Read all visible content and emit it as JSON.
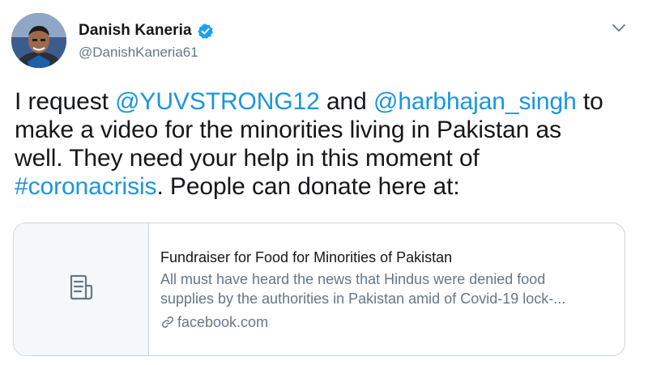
{
  "author": {
    "display_name": "Danish Kaneria",
    "handle": "@DanishKaneria61",
    "verified_icon": "verified-badge-icon",
    "avatar_icon": "profile-photo",
    "colors": {
      "verified": "#1da1f2",
      "secondary_text": "#657786"
    }
  },
  "tweet": {
    "line1_prefix": "I request ",
    "mention1": "@YUVSTRONG12",
    "line1_middle": " and ",
    "mention2": "@harbhajan_singh",
    "line1_suffix": " to",
    "line2": "make a video for the minorities living in Pakistan as",
    "line3": "well. They need your help in this moment of",
    "hashtag": "#coronacrisis",
    "line4_suffix": ". People can donate here at:",
    "colors": {
      "link": "#1b95e0",
      "text": "#14171a"
    }
  },
  "card": {
    "title": "Fundraiser for Food for Minorities of Pakistan",
    "description_line1": "All must have heard the news that Hindus were denied food",
    "description_line2": "supplies by the authorities in Pakistan amid of Covid-19 lock-...",
    "domain": "facebook.com",
    "thumb_icon": "document-icon",
    "link_icon": "link-icon"
  },
  "menu": {
    "caret_icon": "chevron-down-icon"
  }
}
